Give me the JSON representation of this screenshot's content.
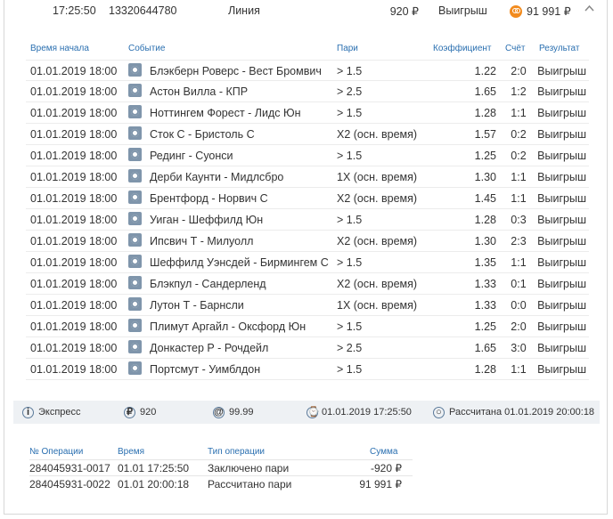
{
  "header": {
    "time": "17:25:50",
    "bet_id": "13320644780",
    "bet_type": "Линия",
    "stake": "920 ₽",
    "result": "Выигрыш",
    "payout": "91 991 ₽"
  },
  "bets_table": {
    "headers": {
      "time": "Время начала",
      "event": "Событие",
      "bet": "Пари",
      "odds": "Коэффициент",
      "score": "Счёт",
      "result": "Результат"
    },
    "rows": [
      {
        "date": "01.01.2019 18:00",
        "event": "Блэкберн Роверс - Вест Бромвич",
        "bet": "> 1.5",
        "odds": "1.22",
        "score": "2:0",
        "result": "Выигрыш"
      },
      {
        "date": "01.01.2019 18:00",
        "event": "Астон Вилла - КПР",
        "bet": "> 2.5",
        "odds": "1.65",
        "score": "1:2",
        "result": "Выигрыш"
      },
      {
        "date": "01.01.2019 18:00",
        "event": "Ноттингем Форест - Лидс Юн",
        "bet": "> 1.5",
        "odds": "1.28",
        "score": "1:1",
        "result": "Выигрыш"
      },
      {
        "date": "01.01.2019 18:00",
        "event": "Сток С - Бристоль С",
        "bet": "Х2 (осн. время)",
        "odds": "1.57",
        "score": "0:2",
        "result": "Выигрыш"
      },
      {
        "date": "01.01.2019 18:00",
        "event": "Рединг - Суонси",
        "bet": "> 1.5",
        "odds": "1.25",
        "score": "0:2",
        "result": "Выигрыш"
      },
      {
        "date": "01.01.2019 18:00",
        "event": "Дерби Каунти - Мидлсбро",
        "bet": "1Х (осн. время)",
        "odds": "1.30",
        "score": "1:1",
        "result": "Выигрыш"
      },
      {
        "date": "01.01.2019 18:00",
        "event": "Брентфорд - Норвич С",
        "bet": "Х2 (осн. время)",
        "odds": "1.45",
        "score": "1:1",
        "result": "Выигрыш"
      },
      {
        "date": "01.01.2019 18:00",
        "event": "Уиган - Шеффилд Юн",
        "bet": "> 1.5",
        "odds": "1.28",
        "score": "0:3",
        "result": "Выигрыш"
      },
      {
        "date": "01.01.2019 18:00",
        "event": "Ипсвич Т - Милуолл",
        "bet": "Х2 (осн. время)",
        "odds": "1.30",
        "score": "2:3",
        "result": "Выигрыш"
      },
      {
        "date": "01.01.2019 18:00",
        "event": "Шеффилд Уэнсдей - Бирмингем С",
        "bet": "> 1.5",
        "odds": "1.35",
        "score": "1:1",
        "result": "Выигрыш"
      },
      {
        "date": "01.01.2019 18:00",
        "event": "Блэкпул - Сандерленд",
        "bet": "Х2 (осн. время)",
        "odds": "1.33",
        "score": "0:1",
        "result": "Выигрыш"
      },
      {
        "date": "01.01.2019 18:00",
        "event": "Лутон Т - Барнсли",
        "bet": "1Х (осн. время)",
        "odds": "1.33",
        "score": "0:0",
        "result": "Выигрыш"
      },
      {
        "date": "01.01.2019 18:00",
        "event": "Плимут Аргайл - Оксфорд Юн",
        "bet": "> 1.5",
        "odds": "1.25",
        "score": "2:0",
        "result": "Выигрыш"
      },
      {
        "date": "01.01.2019 18:00",
        "event": "Донкастер Р - Рочдейл",
        "bet": "> 2.5",
        "odds": "1.65",
        "score": "3:0",
        "result": "Выигрыш"
      },
      {
        "date": "01.01.2019 18:00",
        "event": "Портсмут - Уимблдон",
        "bet": "> 1.5",
        "odds": "1.28",
        "score": "1:1",
        "result": "Выигрыш"
      }
    ]
  },
  "summary": {
    "type": "Экспресс",
    "stake": "920",
    "odds": "99.99",
    "placed": "01.01.2019 17:25:50",
    "status": "Рассчитана 01.01.2019 20:00:18"
  },
  "operations": {
    "headers": {
      "op_no": "№ Операции",
      "time": "Время",
      "op_type": "Тип операции",
      "sum": "Сумма"
    },
    "rows": [
      {
        "op_no": "284045931-0017",
        "time": "01.01 17:25:50",
        "op_type": "Заключено пари",
        "sum": "-920 ₽"
      },
      {
        "op_no": "284045931-0022",
        "time": "01.01 20:00:18",
        "op_type": "Рассчитано пари",
        "sum": "91 991 ₽"
      }
    ]
  },
  "icons": {
    "payout": "payout-coin-icon",
    "collapse": "chevron-up-icon",
    "event": "soccer-ball-icon",
    "info": "info-icon",
    "stake": "ruble-icon",
    "odds": "at-icon",
    "placed": "time-icon",
    "status": "status-circle-icon"
  },
  "colors": {
    "header_link": "#2a6fb0",
    "payout_icon": "#f28b1e",
    "summary_bg": "#eef1f4"
  }
}
